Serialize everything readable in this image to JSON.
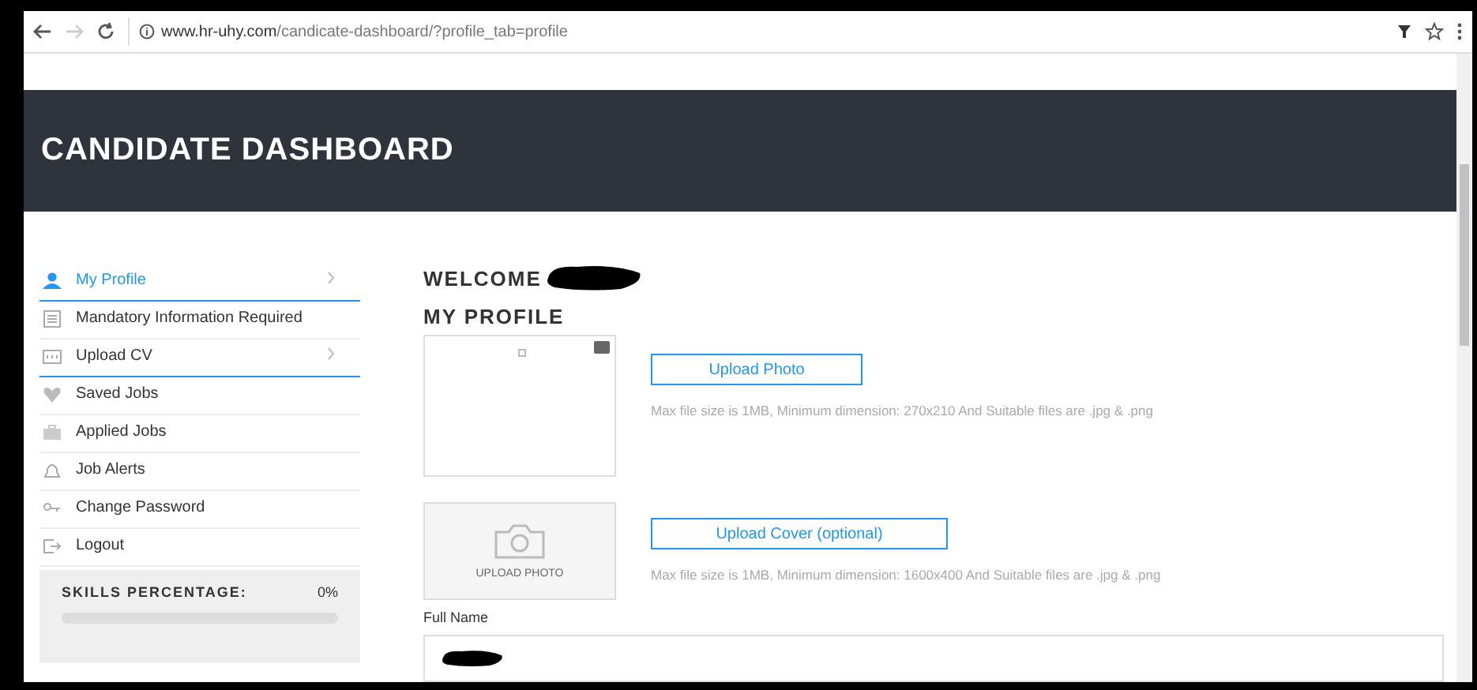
{
  "browser": {
    "url_host": "www.hr-uhy.com",
    "url_path": "/candicate-dashboard/?profile_tab=profile"
  },
  "header": {
    "title": "CANDIDATE DASHBOARD"
  },
  "sidebar": {
    "items": [
      {
        "label": "My Profile",
        "selected": true,
        "kind": "submenu"
      },
      {
        "label": "Mandatory Information Required",
        "selected": false,
        "kind": "plain"
      },
      {
        "label": "Upload CV",
        "selected": false,
        "kind": "submenu"
      },
      {
        "label": "Saved Jobs",
        "selected": false,
        "kind": "plain"
      },
      {
        "label": "Applied Jobs",
        "selected": false,
        "kind": "plain"
      },
      {
        "label": "Job Alerts",
        "selected": false,
        "kind": "plain"
      },
      {
        "label": "Change Password",
        "selected": false,
        "kind": "plain"
      },
      {
        "label": "Logout",
        "selected": false,
        "kind": "plain"
      }
    ],
    "skills": {
      "label": "SKILLS PERCENTAGE:",
      "reading": "0%",
      "level": 0
    }
  },
  "main": {
    "welcome": "WELCOME",
    "heading": "MY PROFILE",
    "photo": {
      "button": "Upload Photo",
      "hint": "Max file size is 1MB, Minimum dimension: 270x210 And Suitable files are .jpg & .png"
    },
    "cover": {
      "placeholder_label": "UPLOAD PHOTO",
      "button": "Upload Cover (optional)",
      "hint": "Max file size is 1MB, Minimum dimension: 1600x400 And Suitable files are .jpg & .png"
    },
    "full_name": {
      "label": "Full Name"
    }
  }
}
